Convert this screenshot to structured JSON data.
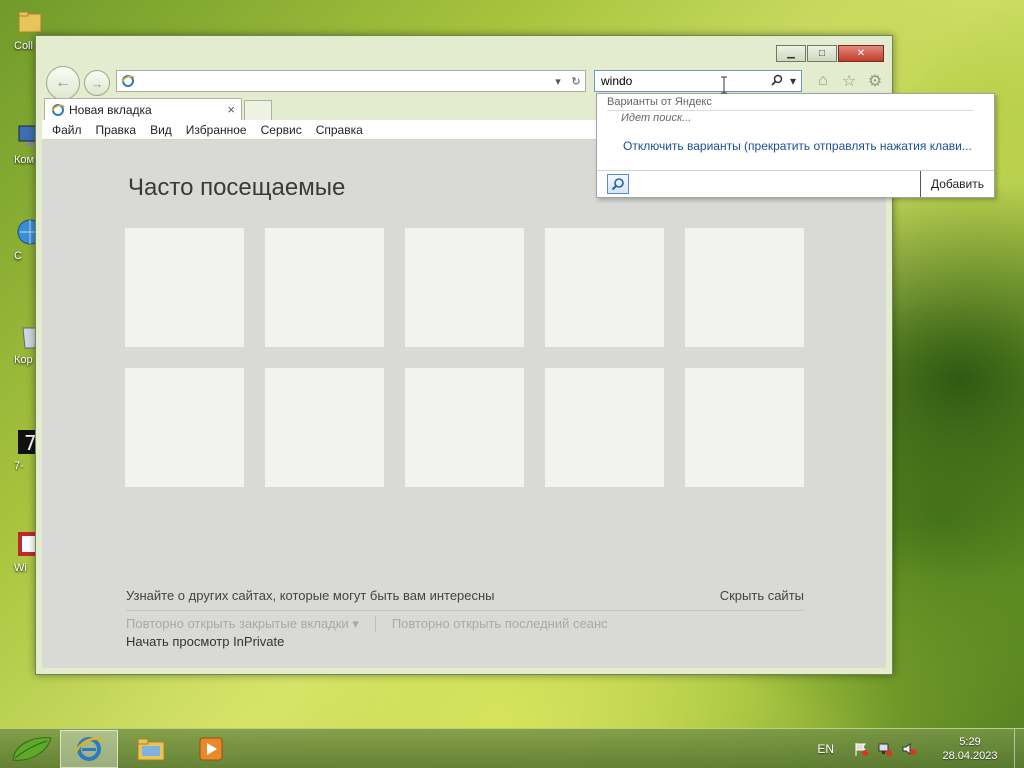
{
  "desktop": {
    "icons": [
      {
        "label": "Coll"
      },
      {
        "label": "Комп"
      },
      {
        "label": "C"
      },
      {
        "label": "Кор"
      },
      {
        "label": "7-"
      },
      {
        "label": "Wi"
      }
    ]
  },
  "browser": {
    "address_value": "",
    "search_value": "windo",
    "tab": {
      "label": "Новая вкладка",
      "close": "×"
    },
    "menu": [
      "Файл",
      "Правка",
      "Вид",
      "Избранное",
      "Сервис",
      "Справка"
    ],
    "caption": {
      "min": "▁",
      "max": "□",
      "close": "✕"
    }
  },
  "newtab_page": {
    "title": "Часто посещаемые",
    "tile_count": 10,
    "discover_text": "Узнайте о других сайтах, которые могут быть вам интересны",
    "hide_sites": "Скрыть сайты",
    "reopen_closed": "Повторно открыть закрытые вкладки ▾",
    "reopen_session": "Повторно открыть последний сеанс",
    "inprivate": "Начать просмотр InPrivate"
  },
  "search_dropdown": {
    "header": "Варианты от Яндекс",
    "status": "Идет поиск...",
    "disable_link": "Отключить варианты (прекратить отправлять нажатия клави...",
    "add_button": "Добавить"
  },
  "taskbar": {
    "language": "EN",
    "time": "5:29",
    "date": "28.04.2023"
  },
  "colors": {
    "window_frame": "#e4ecd0",
    "link": "#1a4f9c",
    "content_bg": "#d9d9d6"
  }
}
